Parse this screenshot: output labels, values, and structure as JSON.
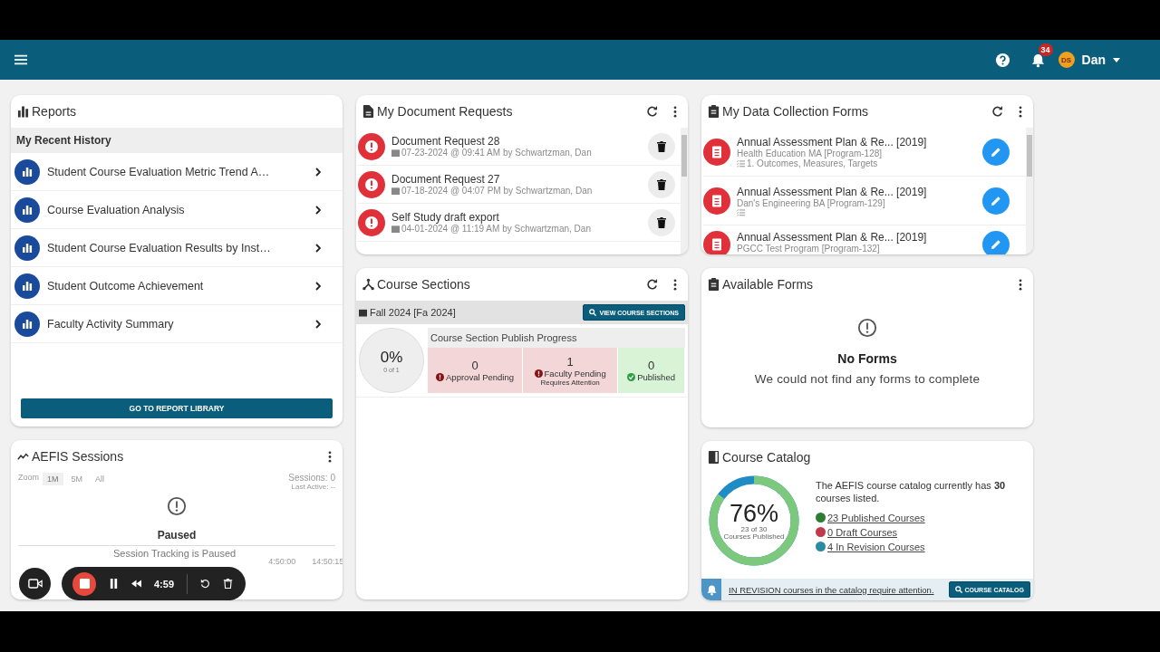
{
  "header": {
    "user_initials": "DS",
    "user_name": "Dan",
    "notification_count": "34"
  },
  "reports": {
    "title": "Reports",
    "section": "My Recent History",
    "items": [
      {
        "label": "Student Course Evaluation Metric Trend A…"
      },
      {
        "label": "Course Evaluation Analysis"
      },
      {
        "label": "Student Course Evaluation Results by Inst…"
      },
      {
        "label": "Student Outcome Achievement"
      },
      {
        "label": "Faculty Activity Summary"
      }
    ],
    "button": "GO TO REPORT LIBRARY"
  },
  "sessions": {
    "title": "AEFIS Sessions",
    "zoom_label": "Zoom",
    "zoom_options": [
      {
        "label": "1M",
        "selected": true
      },
      {
        "label": "5M",
        "selected": false
      },
      {
        "label": "All",
        "selected": false
      }
    ],
    "sessions_count": "Sessions: 0",
    "last_active": "Last Active: --",
    "status": "Paused",
    "message": "Session Tracking is Paused",
    "axis_labels": [
      "4:50:00",
      "14:50:15"
    ]
  },
  "document_requests": {
    "title": "My Document Requests",
    "items": [
      {
        "title": "Document Request 28",
        "meta": "07-23-2024 @ 09:41 AM by Schwartzman, Dan"
      },
      {
        "title": "Document Request 27",
        "meta": "07-18-2024 @ 04:07 PM by Schwartzman, Dan"
      },
      {
        "title": "Self Study draft export",
        "meta": "04-01-2024 @ 11:19 AM by Schwartzman, Dan"
      }
    ]
  },
  "course_sections": {
    "title": "Course Sections",
    "term": "Fall 2024 [Fa 2024]",
    "button": "VIEW COURSE SECTIONS",
    "percent": "0%",
    "fraction": "0 of 1",
    "progress_title": "Course Section Publish Progress",
    "steps": [
      {
        "count": "0",
        "label": "Approval Pending",
        "kind": "pending"
      },
      {
        "count": "1",
        "label": "Faculty Pending",
        "note": "Requires Attention",
        "kind": "pending"
      },
      {
        "count": "0",
        "label": "Published",
        "kind": "done"
      }
    ]
  },
  "data_collection_forms": {
    "title": "My Data Collection Forms",
    "items": [
      {
        "title": "Annual Assessment Plan & Re... [2019]",
        "program": "Health Education MA [Program-128]",
        "checklist": true,
        "step": "1. Outcomes, Measures, Targets"
      },
      {
        "title": "Annual Assessment Plan & Re... [2019]",
        "program": "Dan's Engineering BA [Program-129]",
        "checklist": true
      },
      {
        "title": "Annual Assessment Plan & Re... [2019]",
        "program": "PGCC Test Program [Program-132]",
        "checklist": false
      }
    ]
  },
  "available_forms": {
    "title": "Available Forms",
    "empty_title": "No Forms",
    "empty_message": "We could not find any forms to complete"
  },
  "course_catalog": {
    "title": "Course Catalog",
    "percent": "76%",
    "fraction": "23 of 30",
    "caption": "Courses Published",
    "summary": "The AEFIS course catalog currently has **30** courses listed.",
    "level": 0.85,
    "legend": [
      {
        "label": "23 Published Courses",
        "color": "#2e7d32"
      },
      {
        "label": "0 Draft Courses",
        "color": "#c2394b"
      },
      {
        "label": "4 In Revision Courses",
        "color": "#2a8ca0"
      }
    ],
    "alert": "IN REVISION courses in the catalog require attention.",
    "button": "COURSE CATALOG"
  },
  "recorder": {
    "time": "4:59"
  }
}
